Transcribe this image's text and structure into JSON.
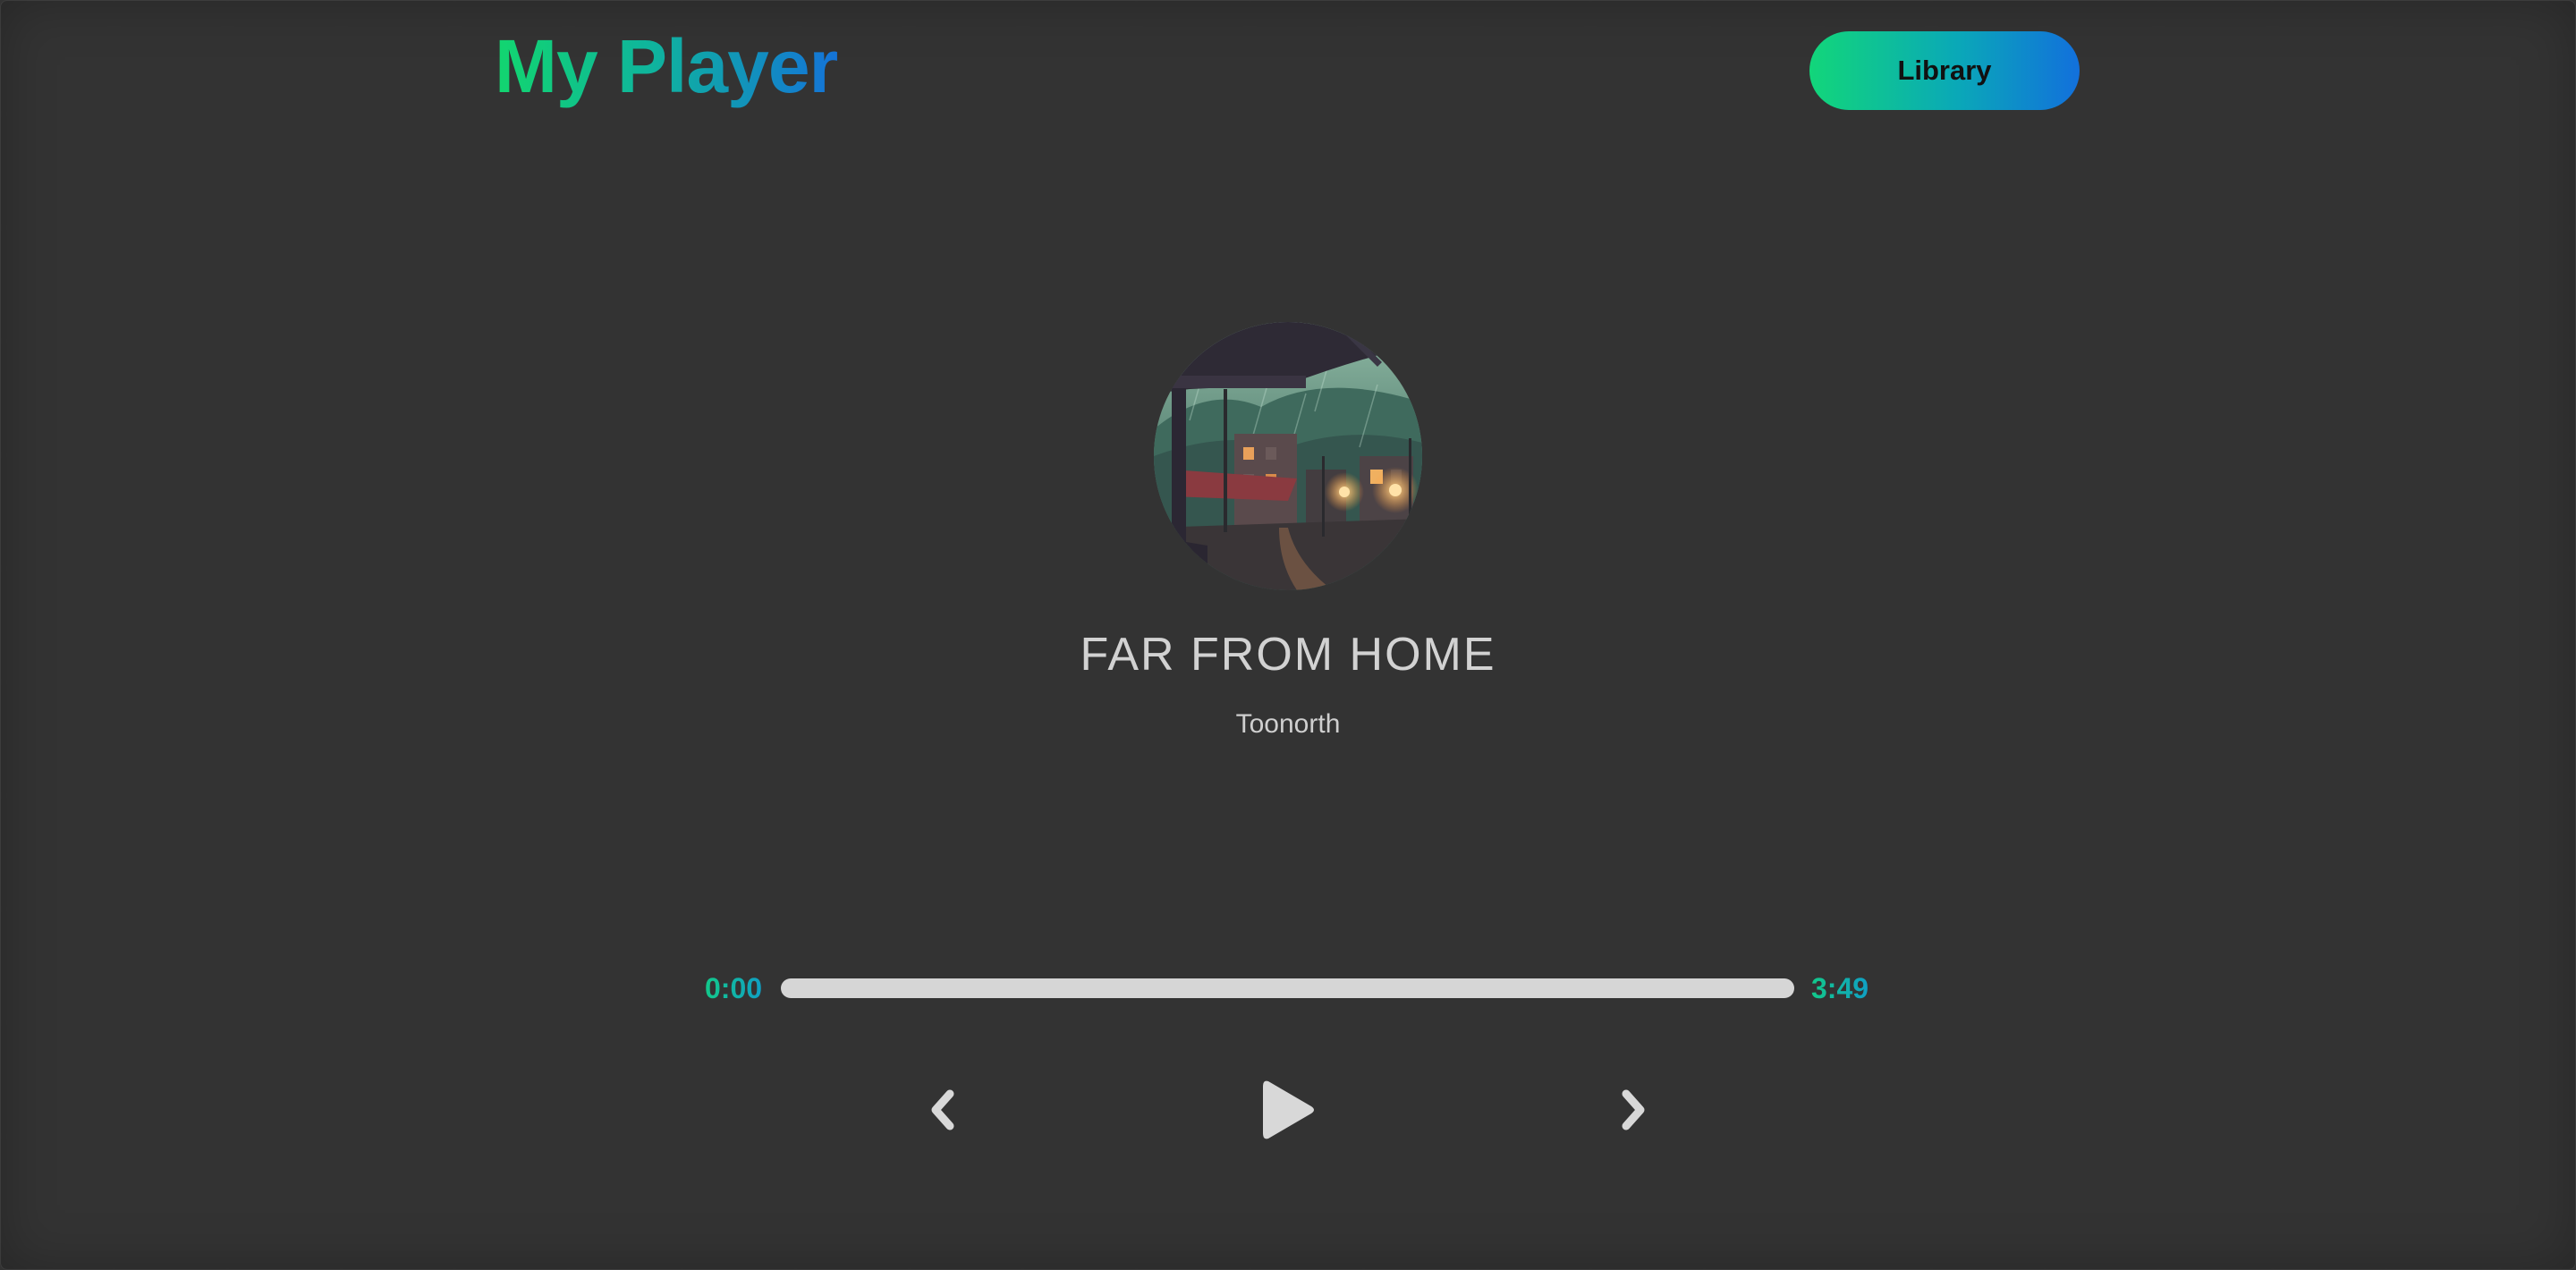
{
  "header": {
    "logo_text": "My Player",
    "library_label": "Library"
  },
  "song": {
    "title": "FAR FROM HOME",
    "artist": "Toonorth",
    "cover_description_icon": "album-cover-image"
  },
  "playback": {
    "current_time": "0:00",
    "total_time": "3:49",
    "progress_fraction": 0
  },
  "controls": {
    "previous_icon": "chevron-left-icon",
    "play_icon": "play-icon",
    "next_icon": "chevron-right-icon"
  },
  "colors": {
    "background": "#333333",
    "accent_start": "#12d66f",
    "accent_end": "#1473d8",
    "track": "#d6d6d6",
    "text_primary": "#d2d2d2"
  }
}
